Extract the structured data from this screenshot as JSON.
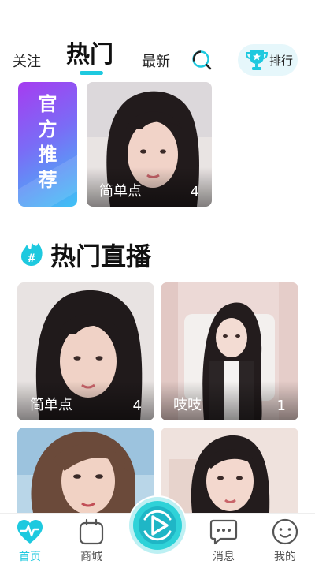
{
  "header": {
    "tabs": [
      {
        "label": "关注",
        "active": false
      },
      {
        "label": "热门",
        "active": true
      },
      {
        "label": "最新",
        "active": false
      }
    ],
    "search_icon": "search-icon",
    "rank_button": {
      "label": "排行",
      "icon": "trophy-icon"
    },
    "accent_color": "#1ec9df"
  },
  "official": {
    "label": "官方推荐",
    "chars": [
      "官",
      "方",
      "推",
      "荐"
    ],
    "card": {
      "name": "简单点",
      "count": "4"
    }
  },
  "section": {
    "title": "热门直播",
    "icon": "hot-flame-icon"
  },
  "live_cards": [
    {
      "name": "简单点",
      "count": "4"
    },
    {
      "name": "吱吱",
      "count": "1"
    },
    {
      "name": "",
      "count": ""
    },
    {
      "name": "",
      "count": ""
    }
  ],
  "bottom_nav": {
    "items": [
      {
        "label": "首页",
        "icon": "heartbeat-icon",
        "active": true
      },
      {
        "label": "商城",
        "icon": "shopping-bag-icon",
        "active": false
      },
      {
        "label": "消息",
        "icon": "chat-bubble-icon",
        "active": false
      },
      {
        "label": "我的",
        "icon": "smiley-icon",
        "active": false
      }
    ],
    "center_icon": "live-play-icon"
  }
}
